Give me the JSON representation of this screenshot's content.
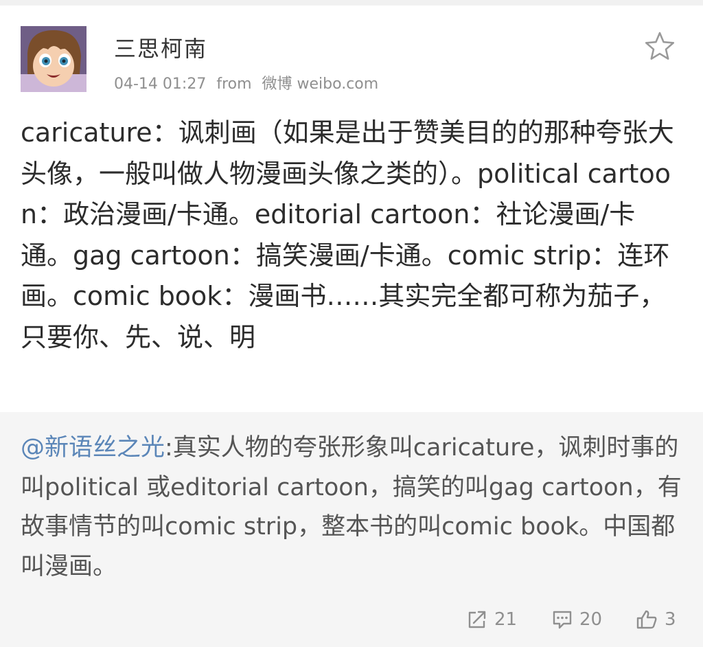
{
  "user": {
    "name": "三思柯南",
    "time": "04-14 01:27",
    "from_label": "from",
    "source": "微博 weibo.com"
  },
  "post": {
    "text": "caricature：讽刺画（如果是出于赞美目的的那种夸张大头像，一般叫做人物漫画头像之类的）。political cartoon：政治漫画/卡通。editorial cartoon：社论漫画/卡通。gag cartoon：搞笑漫画/卡通。comic strip：连环画。comic book：漫画书……其实完全都可称为茄子，只要你、先、说、明"
  },
  "repost": {
    "mention": "@新语丝之光",
    "text": ":真实人物的夸张形象叫caricature，讽刺时事的叫political 或editorial cartoon，搞笑的叫gag cartoon，有故事情节的叫comic strip，整本书的叫comic book。中国都叫漫画。"
  },
  "actions": {
    "repost_count": "21",
    "comment_count": "20",
    "like_count": "3"
  },
  "icons": {
    "favorite": "star-icon",
    "repost": "repost-icon",
    "comment": "comment-icon",
    "like": "thumbs-up-icon"
  },
  "colors": {
    "link": "#5b86b8",
    "muted": "#8f8f8f",
    "quote_bg": "#f5f5f5"
  }
}
